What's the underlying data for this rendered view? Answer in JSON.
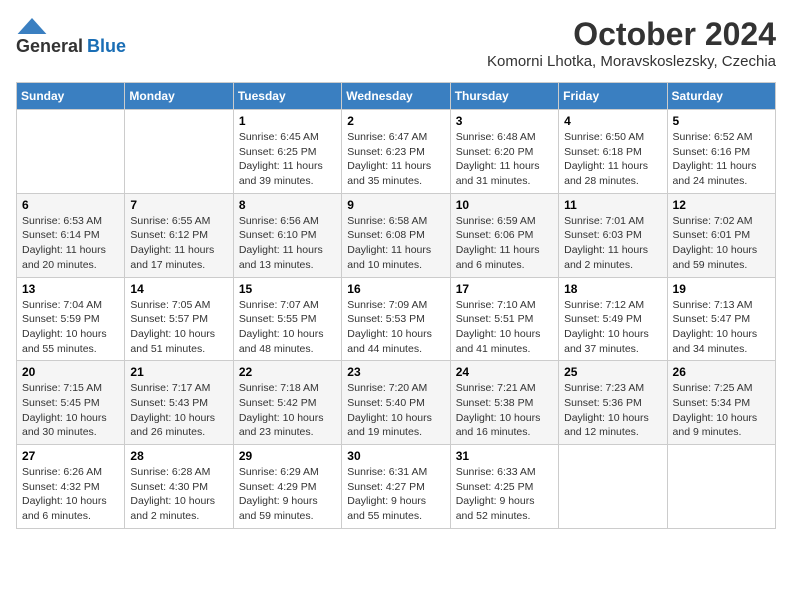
{
  "logo": {
    "general": "General",
    "blue": "Blue"
  },
  "title": "October 2024",
  "subtitle": "Komorni Lhotka, Moravskoslezsky, Czechia",
  "weekdays": [
    "Sunday",
    "Monday",
    "Tuesday",
    "Wednesday",
    "Thursday",
    "Friday",
    "Saturday"
  ],
  "weeks": [
    [
      {
        "day": "",
        "sunrise": "",
        "sunset": "",
        "daylight": ""
      },
      {
        "day": "",
        "sunrise": "",
        "sunset": "",
        "daylight": ""
      },
      {
        "day": "1",
        "sunrise": "Sunrise: 6:45 AM",
        "sunset": "Sunset: 6:25 PM",
        "daylight": "Daylight: 11 hours and 39 minutes."
      },
      {
        "day": "2",
        "sunrise": "Sunrise: 6:47 AM",
        "sunset": "Sunset: 6:23 PM",
        "daylight": "Daylight: 11 hours and 35 minutes."
      },
      {
        "day": "3",
        "sunrise": "Sunrise: 6:48 AM",
        "sunset": "Sunset: 6:20 PM",
        "daylight": "Daylight: 11 hours and 31 minutes."
      },
      {
        "day": "4",
        "sunrise": "Sunrise: 6:50 AM",
        "sunset": "Sunset: 6:18 PM",
        "daylight": "Daylight: 11 hours and 28 minutes."
      },
      {
        "day": "5",
        "sunrise": "Sunrise: 6:52 AM",
        "sunset": "Sunset: 6:16 PM",
        "daylight": "Daylight: 11 hours and 24 minutes."
      }
    ],
    [
      {
        "day": "6",
        "sunrise": "Sunrise: 6:53 AM",
        "sunset": "Sunset: 6:14 PM",
        "daylight": "Daylight: 11 hours and 20 minutes."
      },
      {
        "day": "7",
        "sunrise": "Sunrise: 6:55 AM",
        "sunset": "Sunset: 6:12 PM",
        "daylight": "Daylight: 11 hours and 17 minutes."
      },
      {
        "day": "8",
        "sunrise": "Sunrise: 6:56 AM",
        "sunset": "Sunset: 6:10 PM",
        "daylight": "Daylight: 11 hours and 13 minutes."
      },
      {
        "day": "9",
        "sunrise": "Sunrise: 6:58 AM",
        "sunset": "Sunset: 6:08 PM",
        "daylight": "Daylight: 11 hours and 10 minutes."
      },
      {
        "day": "10",
        "sunrise": "Sunrise: 6:59 AM",
        "sunset": "Sunset: 6:06 PM",
        "daylight": "Daylight: 11 hours and 6 minutes."
      },
      {
        "day": "11",
        "sunrise": "Sunrise: 7:01 AM",
        "sunset": "Sunset: 6:03 PM",
        "daylight": "Daylight: 11 hours and 2 minutes."
      },
      {
        "day": "12",
        "sunrise": "Sunrise: 7:02 AM",
        "sunset": "Sunset: 6:01 PM",
        "daylight": "Daylight: 10 hours and 59 minutes."
      }
    ],
    [
      {
        "day": "13",
        "sunrise": "Sunrise: 7:04 AM",
        "sunset": "Sunset: 5:59 PM",
        "daylight": "Daylight: 10 hours and 55 minutes."
      },
      {
        "day": "14",
        "sunrise": "Sunrise: 7:05 AM",
        "sunset": "Sunset: 5:57 PM",
        "daylight": "Daylight: 10 hours and 51 minutes."
      },
      {
        "day": "15",
        "sunrise": "Sunrise: 7:07 AM",
        "sunset": "Sunset: 5:55 PM",
        "daylight": "Daylight: 10 hours and 48 minutes."
      },
      {
        "day": "16",
        "sunrise": "Sunrise: 7:09 AM",
        "sunset": "Sunset: 5:53 PM",
        "daylight": "Daylight: 10 hours and 44 minutes."
      },
      {
        "day": "17",
        "sunrise": "Sunrise: 7:10 AM",
        "sunset": "Sunset: 5:51 PM",
        "daylight": "Daylight: 10 hours and 41 minutes."
      },
      {
        "day": "18",
        "sunrise": "Sunrise: 7:12 AM",
        "sunset": "Sunset: 5:49 PM",
        "daylight": "Daylight: 10 hours and 37 minutes."
      },
      {
        "day": "19",
        "sunrise": "Sunrise: 7:13 AM",
        "sunset": "Sunset: 5:47 PM",
        "daylight": "Daylight: 10 hours and 34 minutes."
      }
    ],
    [
      {
        "day": "20",
        "sunrise": "Sunrise: 7:15 AM",
        "sunset": "Sunset: 5:45 PM",
        "daylight": "Daylight: 10 hours and 30 minutes."
      },
      {
        "day": "21",
        "sunrise": "Sunrise: 7:17 AM",
        "sunset": "Sunset: 5:43 PM",
        "daylight": "Daylight: 10 hours and 26 minutes."
      },
      {
        "day": "22",
        "sunrise": "Sunrise: 7:18 AM",
        "sunset": "Sunset: 5:42 PM",
        "daylight": "Daylight: 10 hours and 23 minutes."
      },
      {
        "day": "23",
        "sunrise": "Sunrise: 7:20 AM",
        "sunset": "Sunset: 5:40 PM",
        "daylight": "Daylight: 10 hours and 19 minutes."
      },
      {
        "day": "24",
        "sunrise": "Sunrise: 7:21 AM",
        "sunset": "Sunset: 5:38 PM",
        "daylight": "Daylight: 10 hours and 16 minutes."
      },
      {
        "day": "25",
        "sunrise": "Sunrise: 7:23 AM",
        "sunset": "Sunset: 5:36 PM",
        "daylight": "Daylight: 10 hours and 12 minutes."
      },
      {
        "day": "26",
        "sunrise": "Sunrise: 7:25 AM",
        "sunset": "Sunset: 5:34 PM",
        "daylight": "Daylight: 10 hours and 9 minutes."
      }
    ],
    [
      {
        "day": "27",
        "sunrise": "Sunrise: 6:26 AM",
        "sunset": "Sunset: 4:32 PM",
        "daylight": "Daylight: 10 hours and 6 minutes."
      },
      {
        "day": "28",
        "sunrise": "Sunrise: 6:28 AM",
        "sunset": "Sunset: 4:30 PM",
        "daylight": "Daylight: 10 hours and 2 minutes."
      },
      {
        "day": "29",
        "sunrise": "Sunrise: 6:29 AM",
        "sunset": "Sunset: 4:29 PM",
        "daylight": "Daylight: 9 hours and 59 minutes."
      },
      {
        "day": "30",
        "sunrise": "Sunrise: 6:31 AM",
        "sunset": "Sunset: 4:27 PM",
        "daylight": "Daylight: 9 hours and 55 minutes."
      },
      {
        "day": "31",
        "sunrise": "Sunrise: 6:33 AM",
        "sunset": "Sunset: 4:25 PM",
        "daylight": "Daylight: 9 hours and 52 minutes."
      },
      {
        "day": "",
        "sunrise": "",
        "sunset": "",
        "daylight": ""
      },
      {
        "day": "",
        "sunrise": "",
        "sunset": "",
        "daylight": ""
      }
    ]
  ]
}
